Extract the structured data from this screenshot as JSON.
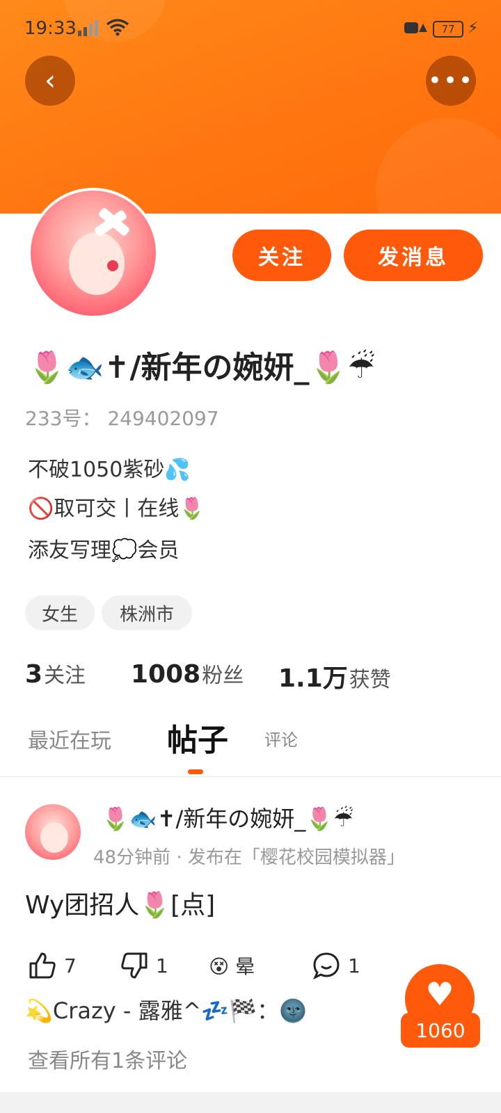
{
  "status_bar": {
    "time": "19:33",
    "battery": "77"
  },
  "header": {
    "back_icon": "‹",
    "more_icon": "•••"
  },
  "profile": {
    "follow_label": "关注",
    "message_label": "发消息",
    "nickname": "🌷🐟✝/新年の婉妍_🌷☔",
    "uid": "233号：  249402097",
    "bio": [
      "不破1050紫砂💦",
      "🚫取可交丨在线🌷",
      "添友写理💭会员"
    ],
    "tags": [
      "女生",
      "株洲市"
    ],
    "stats": [
      {
        "value": "3",
        "label": "关注"
      },
      {
        "value": "1008",
        "label": "粉丝"
      },
      {
        "value": "1.1万",
        "label": "获赞"
      }
    ]
  },
  "tabs": [
    {
      "label": "最近在玩"
    },
    {
      "label": "帖子"
    },
    {
      "label": "评论"
    }
  ],
  "post": {
    "author": "🌷🐟✝/新年の婉妍_🌷☔",
    "meta": "48分钟前 · 发布在「樱花校园模拟器」",
    "title": "Wy团招人🌷[点]",
    "likes": "7",
    "dislikes": "1",
    "comments": "1",
    "emoji_reaction": "😵 晕",
    "comment_preview": "💫Crazy - 露雅^💤🏁：🌚",
    "view_all": "查看所有1条评论"
  },
  "like_fab": {
    "count": "1060"
  }
}
